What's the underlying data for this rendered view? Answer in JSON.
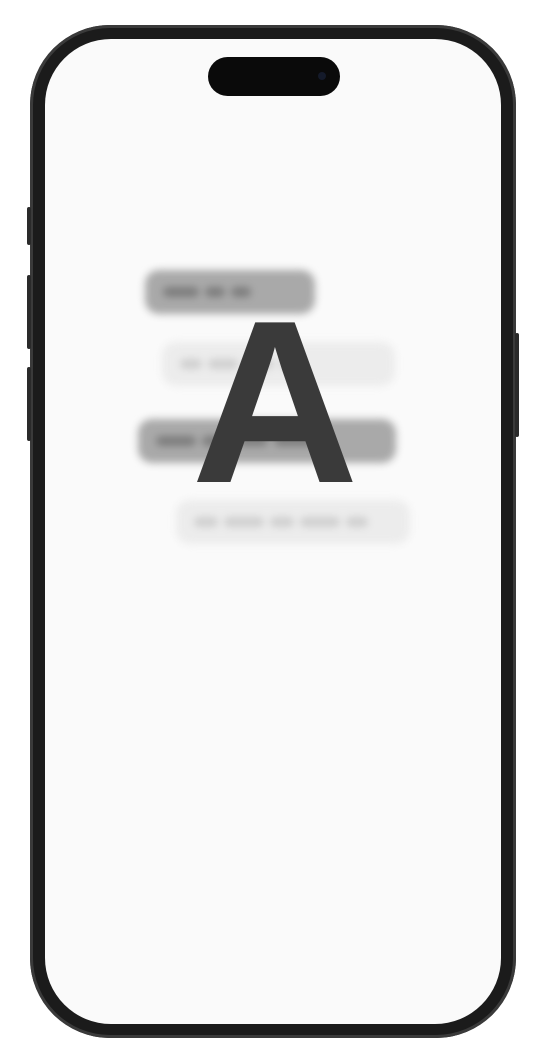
{
  "overlay": {
    "letter": "A"
  },
  "icons": {
    "camera": "camera-icon"
  },
  "colors": {
    "frame": "#1b1b1b",
    "screen": "#fafafa",
    "bubble_dark": "#a9a9a9",
    "bubble_light": "#ececec",
    "letter": "#3a3a3a"
  }
}
